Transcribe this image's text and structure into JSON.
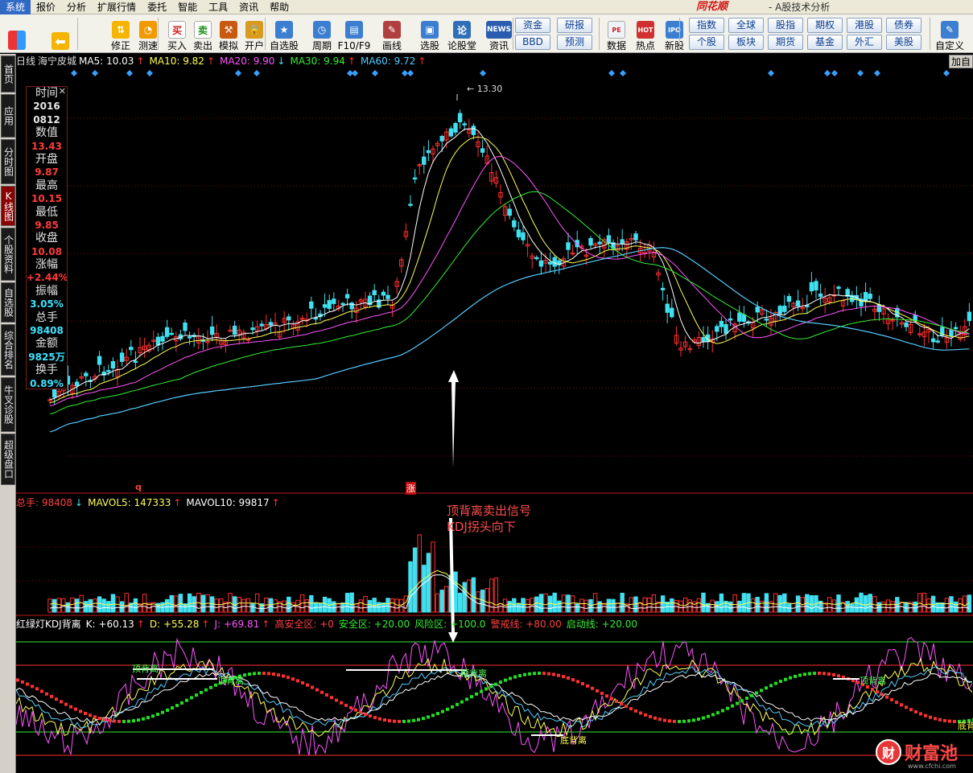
{
  "menu": [
    "系统",
    "报价",
    "分析",
    "扩展行情",
    "委托",
    "智能",
    "工具",
    "资讯",
    "帮助"
  ],
  "brand": "同花顺",
  "app_title": "- A股技术分析",
  "toolbar": {
    "buttons": [
      {
        "label": "修正",
        "icon": "arrow-up-down-icon"
      },
      {
        "label": "测速",
        "icon": "clock-icon"
      },
      {
        "label": "买入",
        "icon": "buy-icon"
      },
      {
        "label": "卖出",
        "icon": "sell-icon"
      },
      {
        "label": "模拟",
        "icon": "hammer-icon"
      },
      {
        "label": "开户",
        "icon": "lock-icon"
      },
      {
        "label": "自选股",
        "icon": "star-icon"
      },
      {
        "label": "周期",
        "icon": "clock-cycle-icon"
      },
      {
        "label": "F10/F9",
        "icon": "doc-icon"
      },
      {
        "label": "画线",
        "icon": "pen-icon"
      },
      {
        "label": "选股",
        "icon": "monitor-icon"
      },
      {
        "label": "论股堂",
        "icon": "lun-icon"
      },
      {
        "label": "资讯",
        "icon": "news-icon"
      },
      {
        "label": "数据",
        "icon": "pe-icon"
      },
      {
        "label": "热点",
        "icon": "hot-icon"
      },
      {
        "label": "新股",
        "icon": "ipo-icon"
      },
      {
        "label": "自定义",
        "icon": "custom-icon"
      }
    ],
    "ic_news": "NEWS",
    "ic_pe": "PE",
    "ic_buy": "买",
    "ic_sell": "卖",
    "ic_lun": "论",
    "ic_hot": "HOT",
    "ic_ipo": "IPO",
    "grid_buttons": [
      [
        "资金",
        "研报"
      ],
      [
        "BBD",
        "预测"
      ]
    ],
    "market_buttons": [
      [
        "指数",
        "全球",
        "股指",
        "期权",
        "港股",
        "债券"
      ],
      [
        "个股",
        "板块",
        "期货",
        "基金",
        "外汇",
        "美股"
      ]
    ]
  },
  "left_tabs": [
    {
      "label": "首页",
      "active": false
    },
    {
      "label": "应用",
      "active": false
    },
    {
      "label": "分时图",
      "active": false
    },
    {
      "label": "K线图",
      "active": true
    },
    {
      "label": "个股资料",
      "active": false
    },
    {
      "label": "自选股",
      "active": false
    },
    {
      "label": "综合排名",
      "active": false
    },
    {
      "label": "牛叉诊股",
      "active": false
    },
    {
      "label": "超级盘口",
      "active": false
    }
  ],
  "ma_bar": {
    "period": "日线",
    "stock": "海宁皮城",
    "items": [
      {
        "text": "MA5: 10.03",
        "arrow": "↑",
        "color": "#ffffff"
      },
      {
        "text": "MA10: 9.82",
        "arrow": "↑",
        "color": "#ffff55"
      },
      {
        "text": "MA20: 9.90",
        "arrow": "↓",
        "color": "#ff55ff"
      },
      {
        "text": "MA30: 9.94",
        "arrow": "↑",
        "color": "#33ee33"
      },
      {
        "text": "MA60: 9.72",
        "arrow": "↑",
        "color": "#55ccff"
      }
    ],
    "add_button": "加自选"
  },
  "info": {
    "time_label": "时间",
    "date1": "2016",
    "date2": "0812",
    "value_label": "数值",
    "value": "13.43",
    "open_label": "开盘",
    "open": "9.87",
    "high_label": "最高",
    "high": "10.15",
    "low_label": "最低",
    "low": "9.85",
    "close_label": "收盘",
    "close": "10.08",
    "change_label": "涨幅",
    "change": "+2.44%",
    "amplitude_label": "振幅",
    "amplitude": "3.05%",
    "volume_label": "总手",
    "volume": "98408",
    "amount_label": "金额",
    "amount": "9825万",
    "turnover_label": "换手",
    "turnover": "0.89%"
  },
  "price_annotations": {
    "peak_label": "13.30",
    "event_q": "q",
    "event_zhang": "涨"
  },
  "volume_bar": {
    "items": [
      {
        "text": "总手: 98408",
        "arrow": "↓",
        "color": "#ff4040"
      },
      {
        "text": "MAVOL5: 147333",
        "arrow": "↑",
        "color": "#ffff55"
      },
      {
        "text": "MAVOL10: 99817",
        "arrow": "↑",
        "color": "#ffffff"
      }
    ]
  },
  "kdj_bar": {
    "items": [
      {
        "text": "红绿灯KDJ背离",
        "color": "#ffffff"
      },
      {
        "text": "K: +60.13",
        "arrow": "↑",
        "color": "#ffffff"
      },
      {
        "text": "D: +55.28",
        "arrow": "↑",
        "color": "#ffff55"
      },
      {
        "text": "J: +69.81",
        "arrow": "↑",
        "color": "#ff55ff"
      },
      {
        "text": "高安全区: +0",
        "color": "#ff4040"
      },
      {
        "text": "安全区: +20.00",
        "color": "#33ee33"
      },
      {
        "text": "风险区: +100.0",
        "color": "#33ee33"
      },
      {
        "text": "警戒线: +80.00",
        "color": "#ff4040"
      },
      {
        "text": "启动线: +20.00",
        "color": "#33ee33"
      }
    ]
  },
  "annotation": {
    "line1": "顶背离卖出信号",
    "line2": "KDJ拐头向下"
  },
  "divergence_labels": [
    "顶背离",
    "顶背离",
    "顶背离",
    "底背离",
    "顶背离",
    "底背"
  ],
  "watermark": {
    "logo": "财",
    "name": "财富池",
    "url": "www.cfchi.com"
  },
  "colors": {
    "up": "#ff3030",
    "down": "#40e0f0",
    "ma5": "#ffffff",
    "ma10": "#ffff55",
    "ma20": "#ff55ff",
    "ma30": "#33ee33",
    "ma60": "#55ccff",
    "grid": "#7a1010"
  },
  "chart_data": {
    "type": "candlestick",
    "visible_price_labels": [
      "13.30"
    ],
    "note_values": {
      "peak_high": 13.3,
      "selected_day": "20160812"
    },
    "oscillator_levels": {
      "warning": 80,
      "start": 20,
      "risk": 100
    }
  }
}
